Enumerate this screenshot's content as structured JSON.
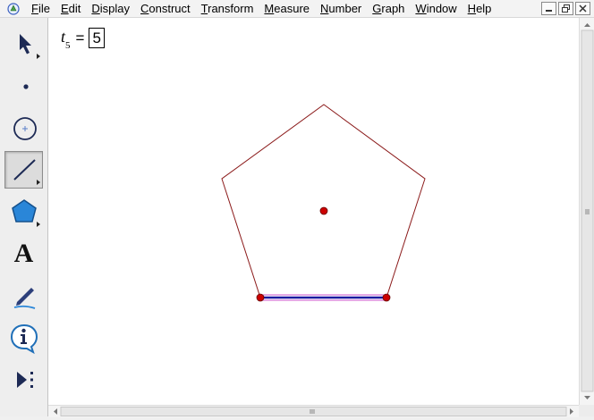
{
  "menu": {
    "items": [
      "File",
      "Edit",
      "Display",
      "Construct",
      "Transform",
      "Measure",
      "Number",
      "Graph",
      "Window",
      "Help"
    ]
  },
  "window_buttons": [
    "minimize-icon",
    "restore-icon",
    "close-icon"
  ],
  "toolbar": {
    "tools": [
      {
        "name": "arrow-tool",
        "icon": "arrow-icon",
        "active": false
      },
      {
        "name": "point-tool",
        "icon": "point-icon",
        "active": false
      },
      {
        "name": "compass-tool",
        "icon": "compass-icon",
        "active": false
      },
      {
        "name": "straightedge-tool",
        "icon": "segment-icon",
        "active": true
      },
      {
        "name": "polygon-tool",
        "icon": "polygon-icon",
        "active": false
      },
      {
        "name": "text-tool",
        "icon": "text-icon",
        "active": false,
        "glyph": "A"
      },
      {
        "name": "marker-tool",
        "icon": "marker-icon",
        "active": false
      },
      {
        "name": "information-tool",
        "icon": "information-icon",
        "active": false
      },
      {
        "name": "custom-tool",
        "icon": "custom-tool-icon",
        "active": false
      }
    ]
  },
  "parameter": {
    "variable": "t",
    "subscript": "5",
    "equals": "=",
    "value": "5"
  },
  "figure": {
    "shape": "regular pentagon",
    "polygon_color": "#8b1a1a",
    "point_color": "#cc0000",
    "segment_color": "#1a1aa0",
    "segment_highlight": "#cc55cc"
  },
  "colors": {
    "canvas": "#ffffff",
    "toolbar": "#eeeeee",
    "menubar": "#f3f3f3"
  }
}
